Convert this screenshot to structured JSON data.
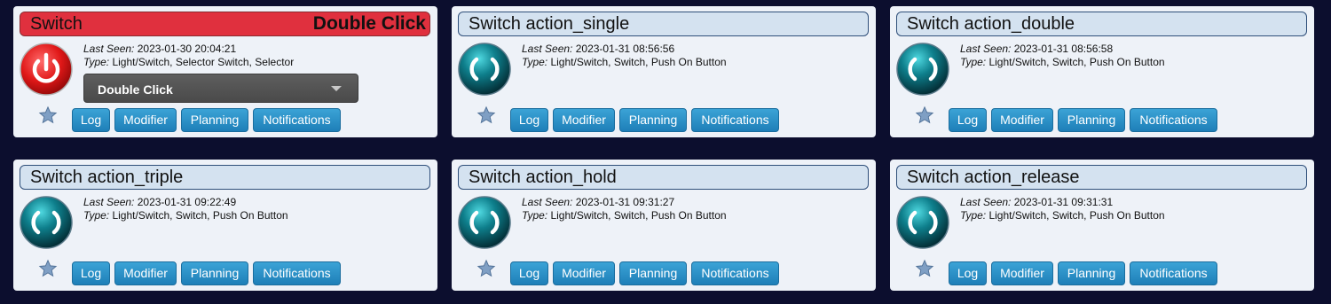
{
  "cards": [
    {
      "name": "Switch",
      "status": "Double Click",
      "last_seen_label": "Last Seen:",
      "last_seen": "2023-01-30 20:04:21",
      "type_label": "Type:",
      "type": "Light/Switch, Selector Switch, Selector",
      "dropdown_value": "Double Click",
      "icon": "power-on-icon",
      "buttons": {
        "log": "Log",
        "modifier": "Modifier",
        "planning": "Planning",
        "notifications": "Notifications"
      }
    },
    {
      "name": "Switch action_single",
      "last_seen_label": "Last Seen:",
      "last_seen": "2023-01-31 08:56:56",
      "type_label": "Type:",
      "type": "Light/Switch, Switch, Push On Button",
      "icon": "push-button-icon",
      "buttons": {
        "log": "Log",
        "modifier": "Modifier",
        "planning": "Planning",
        "notifications": "Notifications"
      }
    },
    {
      "name": "Switch action_double",
      "last_seen_label": "Last Seen:",
      "last_seen": "2023-01-31 08:56:58",
      "type_label": "Type:",
      "type": "Light/Switch, Switch, Push On Button",
      "icon": "push-button-icon",
      "buttons": {
        "log": "Log",
        "modifier": "Modifier",
        "planning": "Planning",
        "notifications": "Notifications"
      }
    },
    {
      "name": "Switch action_triple",
      "last_seen_label": "Last Seen:",
      "last_seen": "2023-01-31 09:22:49",
      "type_label": "Type:",
      "type": "Light/Switch, Switch, Push On Button",
      "icon": "push-button-icon",
      "buttons": {
        "log": "Log",
        "modifier": "Modifier",
        "planning": "Planning",
        "notifications": "Notifications"
      }
    },
    {
      "name": "Switch action_hold",
      "last_seen_label": "Last Seen:",
      "last_seen": "2023-01-31 09:31:27",
      "type_label": "Type:",
      "type": "Light/Switch, Switch, Push On Button",
      "icon": "push-button-icon",
      "buttons": {
        "log": "Log",
        "modifier": "Modifier",
        "planning": "Planning",
        "notifications": "Notifications"
      }
    },
    {
      "name": "Switch action_release",
      "last_seen_label": "Last Seen:",
      "last_seen": "2023-01-31 09:31:31",
      "type_label": "Type:",
      "type": "Light/Switch, Switch, Push On Button",
      "icon": "push-button-icon",
      "buttons": {
        "log": "Log",
        "modifier": "Modifier",
        "planning": "Planning",
        "notifications": "Notifications"
      }
    }
  ],
  "colors": {
    "page_background": "#0c0e2e",
    "card_background": "#eef2f8",
    "title_bar": "#d4e2f0",
    "title_bar_active": "#e0303e",
    "button": "#2a8fc7"
  }
}
